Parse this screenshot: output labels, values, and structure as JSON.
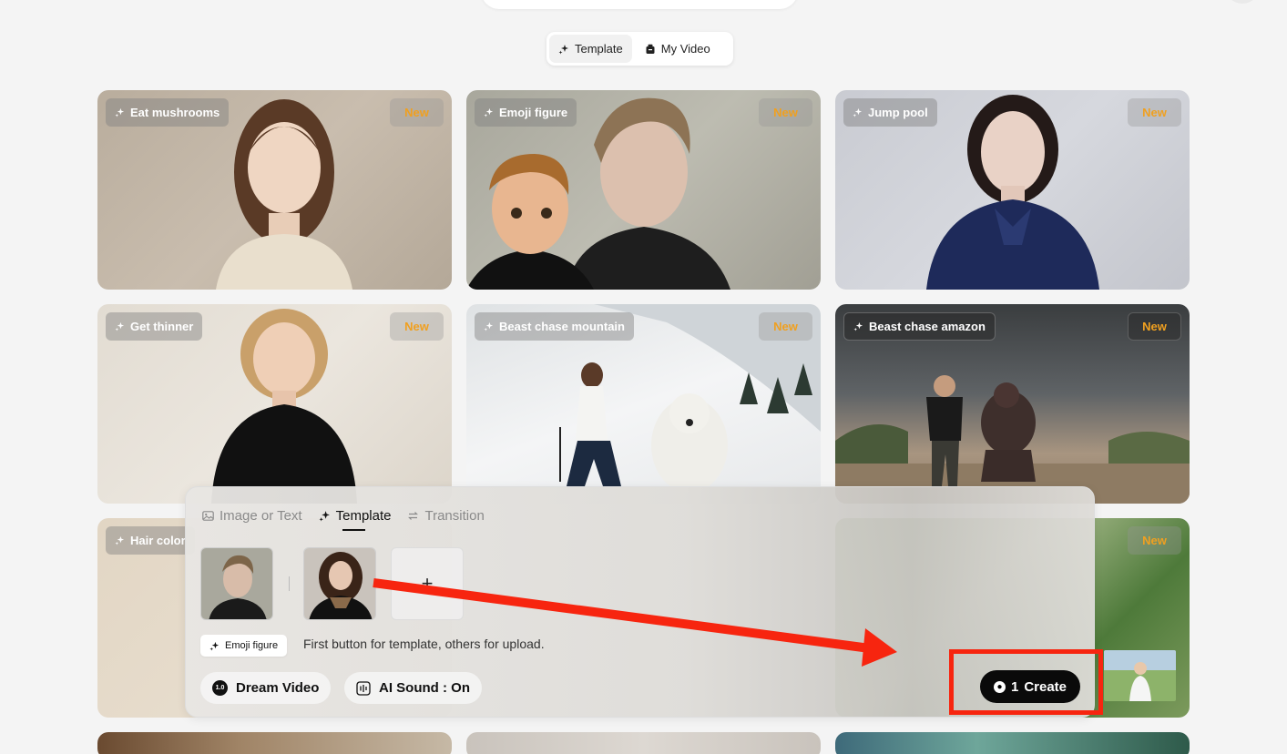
{
  "header": {
    "mode_tabs": [
      {
        "label": "Template",
        "icon": "sparkle-icon",
        "active": true
      },
      {
        "label": "My Video",
        "icon": "video-box-icon",
        "active": false
      }
    ]
  },
  "cards": [
    {
      "tag": "Eat mushrooms",
      "badge": "New"
    },
    {
      "tag": "Emoji figure",
      "badge": "New"
    },
    {
      "tag": "Jump pool",
      "badge": "New"
    },
    {
      "tag": "Get thinner",
      "badge": "New"
    },
    {
      "tag": "Beast chase mountain",
      "badge": "New"
    },
    {
      "tag": "Beast chase amazon",
      "badge": "New"
    },
    {
      "tag": "Hair color",
      "badge": ""
    },
    {
      "tag": "",
      "badge": "New"
    }
  ],
  "panel": {
    "tabs": [
      {
        "label": "Image or Text",
        "icon": "image-icon",
        "active": false
      },
      {
        "label": "Template",
        "icon": "sparkle-icon",
        "active": true
      },
      {
        "label": "Transition",
        "icon": "swap-icon",
        "active": false
      }
    ],
    "add_symbol": "+",
    "template_chip": "Emoji figure",
    "hint": "First button for template, others for upload.",
    "model_version": "1.0",
    "model_label": "Dream Video",
    "sound_label": "AI Sound : On",
    "create_cost": "1",
    "create_label": "Create"
  },
  "colors": {
    "accent_badge": "#f0a020",
    "annotation_red": "#f7250f",
    "create_button": "#0a0a0a"
  }
}
